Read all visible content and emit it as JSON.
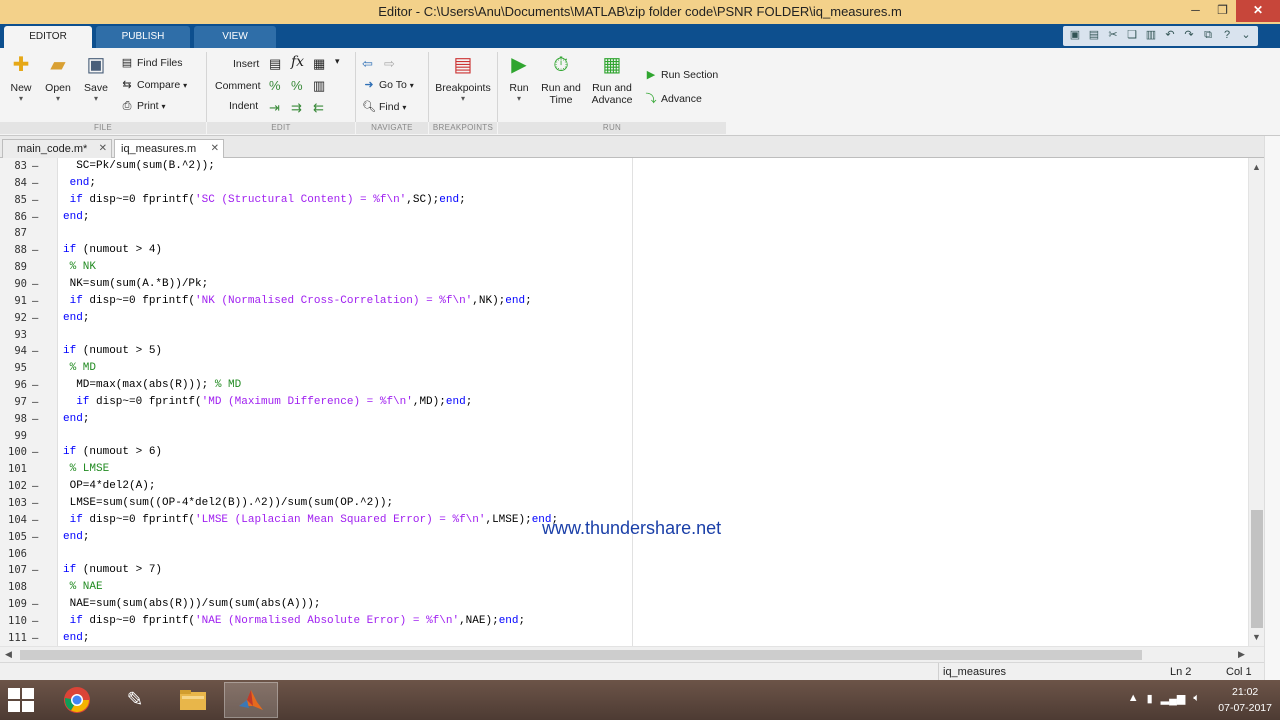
{
  "window": {
    "title": "Editor - C:\\Users\\Anu\\Documents\\MATLAB\\zip folder code\\PSNR FOLDER\\iq_measures.m",
    "controls": [
      "─",
      "❐",
      "✕"
    ]
  },
  "ribbon_tabs": [
    {
      "label": "EDITOR",
      "active": true
    },
    {
      "label": "PUBLISH",
      "active": false
    },
    {
      "label": "VIEW",
      "active": false
    }
  ],
  "ribbon": {
    "file": {
      "group": "FILE",
      "new": "New",
      "open": "Open",
      "save": "Save",
      "find_files": "Find Files",
      "compare": "Compare",
      "print": "Print"
    },
    "edit": {
      "group": "EDIT",
      "insert": "Insert",
      "comment": "Comment",
      "indent": "Indent"
    },
    "navigate": {
      "group": "NAVIGATE",
      "goto": "Go To",
      "find": "Find"
    },
    "breakpoints": {
      "group": "BREAKPOINTS",
      "breakpoints": "Breakpoints"
    },
    "run": {
      "group": "RUN",
      "run": "Run",
      "run_and_time": "Run and Time",
      "run_and_advance": "Run and Advance",
      "run_section": "Run Section",
      "advance": "Advance"
    }
  },
  "doc_tabs": [
    {
      "label": "main_code.m*",
      "active": false
    },
    {
      "label": "iq_measures.m",
      "active": true
    }
  ],
  "code_lines": [
    {
      "n": "83",
      "mark": "–",
      "html": "  SC=Pk/sum(sum(B.^2));"
    },
    {
      "n": "84",
      "mark": "–",
      "html": " <span class=\"kw\">end</span>;"
    },
    {
      "n": "85",
      "mark": "–",
      "html": " <span class=\"kw\">if</span> disp~=0 fprintf(<span class=\"str\">'SC (Structural Content) = %f\\n'</span>,SC);<span class=\"kw\">end</span>;"
    },
    {
      "n": "86",
      "mark": "–",
      "html": "<span class=\"kw\">end</span>;"
    },
    {
      "n": "87",
      "mark": "",
      "html": ""
    },
    {
      "n": "88",
      "mark": "–",
      "html": "<span class=\"kw\">if</span> (numout &gt; 4)"
    },
    {
      "n": "89",
      "mark": "",
      "html": " <span class=\"cm\">% NK</span>"
    },
    {
      "n": "90",
      "mark": "–",
      "html": " NK=sum(sum(A.*B))/Pk;"
    },
    {
      "n": "91",
      "mark": "–",
      "html": " <span class=\"kw\">if</span> disp~=0 fprintf(<span class=\"str\">'NK (Normalised Cross-Correlation) = %f\\n'</span>,NK);<span class=\"kw\">end</span>;"
    },
    {
      "n": "92",
      "mark": "–",
      "html": "<span class=\"kw\">end</span>;"
    },
    {
      "n": "93",
      "mark": "",
      "html": ""
    },
    {
      "n": "94",
      "mark": "–",
      "html": "<span class=\"kw\">if</span> (numout &gt; 5)"
    },
    {
      "n": "95",
      "mark": "",
      "html": " <span class=\"cm\">% MD</span>"
    },
    {
      "n": "96",
      "mark": "–",
      "html": "  MD=max(max(abs(R))); <span class=\"cm\">% MD</span>"
    },
    {
      "n": "97",
      "mark": "–",
      "html": "  <span class=\"kw\">if</span> disp~=0 fprintf(<span class=\"str\">'MD (Maximum Difference) = %f\\n'</span>,MD);<span class=\"kw\">end</span>;"
    },
    {
      "n": "98",
      "mark": "–",
      "html": "<span class=\"kw\">end</span>;"
    },
    {
      "n": "99",
      "mark": "",
      "html": ""
    },
    {
      "n": "100",
      "mark": "–",
      "html": "<span class=\"kw\">if</span> (numout &gt; 6)"
    },
    {
      "n": "101",
      "mark": "",
      "html": " <span class=\"cm\">% LMSE</span>"
    },
    {
      "n": "102",
      "mark": "–",
      "html": " OP=4*del2(A);"
    },
    {
      "n": "103",
      "mark": "–",
      "html": " LMSE=sum(sum((OP-4*del2(B)).^2))/sum(sum(OP.^2));"
    },
    {
      "n": "104",
      "mark": "–",
      "html": " <span class=\"kw\">if</span> disp~=0 fprintf(<span class=\"str\">'LMSE (Laplacian Mean Squared Error) = %f\\n'</span>,LMSE);<span class=\"kw\">end</span>;"
    },
    {
      "n": "105",
      "mark": "–",
      "html": "<span class=\"kw\">end</span>;"
    },
    {
      "n": "106",
      "mark": "",
      "html": ""
    },
    {
      "n": "107",
      "mark": "–",
      "html": "<span class=\"kw\">if</span> (numout &gt; 7)"
    },
    {
      "n": "108",
      "mark": "",
      "html": " <span class=\"cm\">% NAE</span>"
    },
    {
      "n": "109",
      "mark": "–",
      "html": " NAE=sum(sum(abs(R)))/sum(sum(abs(A)));"
    },
    {
      "n": "110",
      "mark": "–",
      "html": " <span class=\"kw\">if</span> disp~=0 fprintf(<span class=\"str\">'NAE (Normalised Absolute Error) = %f\\n'</span>,NAE);<span class=\"kw\">end</span>;"
    },
    {
      "n": "111",
      "mark": "–",
      "html": "<span class=\"kw\">end</span>;"
    }
  ],
  "watermark": "www.thundershare.net",
  "status": {
    "function_name": "iq_measures",
    "ln": "Ln  2",
    "col": "Col  1"
  },
  "taskbar": {
    "time": "21:02",
    "date": "07-07-2017"
  },
  "colors": {
    "keyword": "#0000ff",
    "string": "#a020f0",
    "comment": "#228b22",
    "title_bar": "#f3d18a",
    "tab_strip": "#0d4f8e"
  }
}
